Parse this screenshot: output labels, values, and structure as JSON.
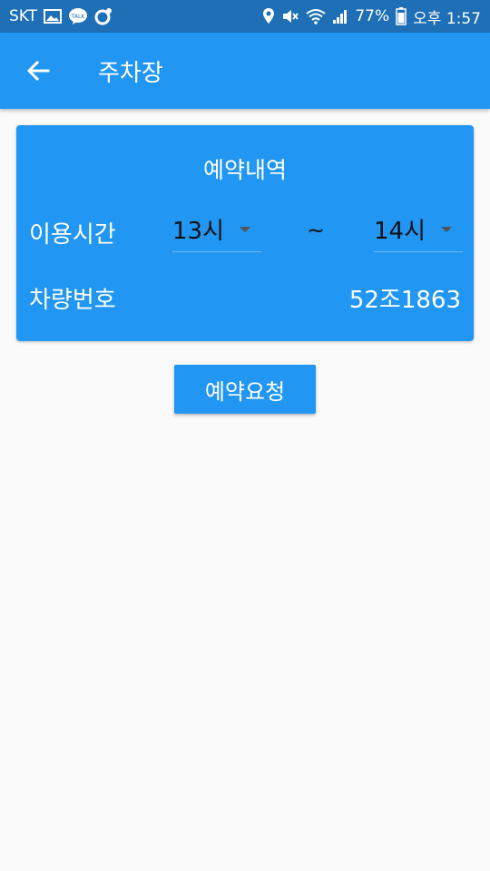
{
  "status_bar": {
    "carrier": "SKT",
    "left_icons": [
      "image-icon",
      "kakaotalk-icon",
      "notification-icon"
    ],
    "right_icons": [
      "location-icon",
      "mute-icon",
      "wifi-icon",
      "signal-icon",
      "battery-icon"
    ],
    "battery": "77%",
    "time": "오후 1:57"
  },
  "app_bar": {
    "back_icon": "arrow-left-icon",
    "title": "주차장"
  },
  "reservation": {
    "title": "예약내역",
    "usage_time_label": "이용시간",
    "start_time": "13시",
    "separator": "~",
    "end_time": "14시",
    "vehicle_label": "차량번호",
    "vehicle_number": "52조1863"
  },
  "request_button": "예약요청",
  "colors": {
    "status_bar": "#1e6fb6",
    "primary": "#2196f3",
    "background": "#fafafa"
  }
}
